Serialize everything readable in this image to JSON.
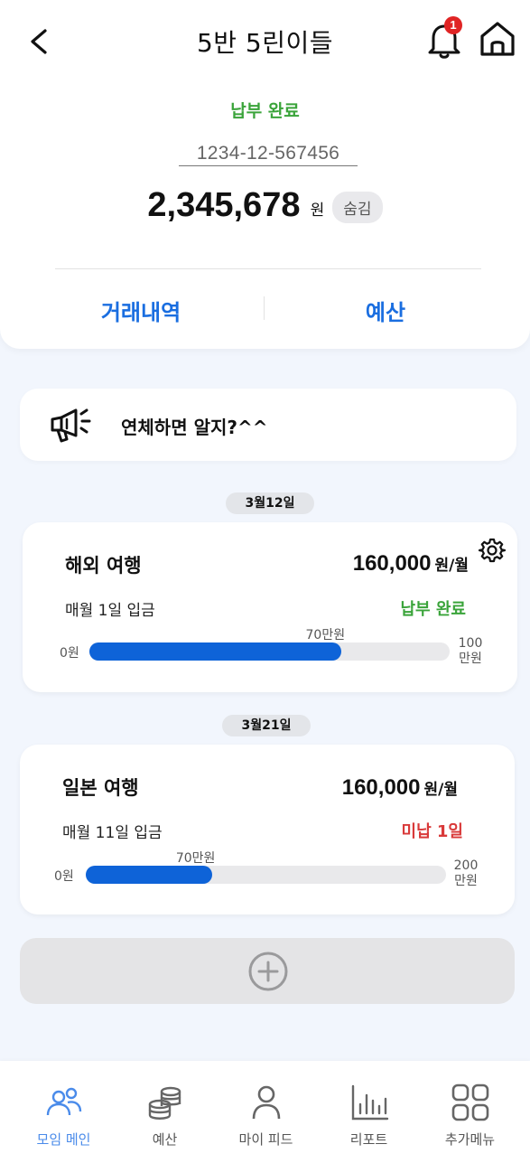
{
  "header": {
    "title": "5반 5린이들",
    "notification_count": "1",
    "back_icon": "chevron-left-icon",
    "bell_icon": "bell-icon",
    "home_icon": "home-icon"
  },
  "summary": {
    "pay_status": "납부 완료",
    "account_number": "1234-12-567456",
    "balance": "2,345,678",
    "balance_unit": "원",
    "hide_label": "숨김"
  },
  "tabs": [
    {
      "label": "거래내역"
    },
    {
      "label": "예산"
    }
  ],
  "notice": {
    "icon": "megaphone-icon",
    "text": "연체하면 알지?^^"
  },
  "plans": [
    {
      "date": "3월12일",
      "name": "해외 여행",
      "amount": "160,000",
      "amount_unit": "원/월",
      "schedule": "매월 1일 입금",
      "status": "납부 완료",
      "bar_min": "0원",
      "bar_max_line1": "100",
      "bar_max_line2": "만원",
      "bar_current": "70만원",
      "progress": 0.7
    },
    {
      "date": "3월21일",
      "name": "일본 여행",
      "amount": "160,000",
      "amount_unit": "원/월",
      "schedule": "매월 11일 입금",
      "status": "미납 1일",
      "bar_min": "0원",
      "bar_max_line1": "200",
      "bar_max_line2": "만원",
      "bar_current": "70만원",
      "progress": 0.35
    }
  ],
  "add_icon": "plus-circle-icon",
  "nav": [
    {
      "label": "모임 메인",
      "icon": "people-icon",
      "active": true
    },
    {
      "label": "예산",
      "icon": "coins-icon",
      "active": false
    },
    {
      "label": "마이 피드",
      "icon": "person-icon",
      "active": false
    },
    {
      "label": "리포트",
      "icon": "bar-chart-icon",
      "active": false
    },
    {
      "label": "추가메뉴",
      "icon": "grid-icon",
      "active": false
    }
  ],
  "colors": {
    "accent": "#1a6ee0",
    "progress": "#0e63d8",
    "paid": "#3aa43a",
    "overdue": "#d93a3a",
    "nav_active": "#4a8bea",
    "background": "#f2f6fd"
  }
}
